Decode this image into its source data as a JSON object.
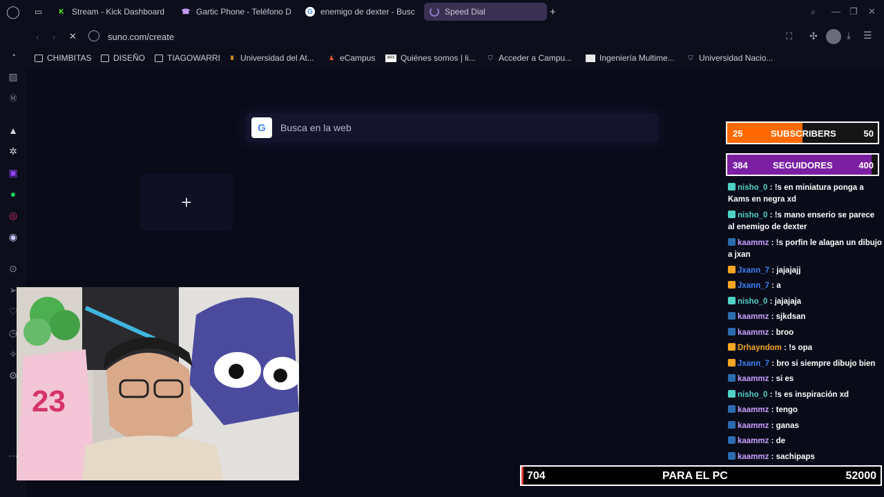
{
  "tabs": [
    {
      "label": "Stream - Kick Dashboard",
      "favicon": "K",
      "color": "#53fc18"
    },
    {
      "label": "Gartic Phone - Teléfono D",
      "favicon": "☎",
      "color": "#9b5de5"
    },
    {
      "label": "enemigo de dexter - Busc",
      "favicon": "G",
      "color": "#ffffff"
    },
    {
      "label": "Speed Dial",
      "favicon": "loading-spinner",
      "color": "#8b7cc8"
    }
  ],
  "address": {
    "url": "suno.com/create"
  },
  "bookmarks": [
    {
      "label": "CHIMBITAS",
      "icon": "folder-icon"
    },
    {
      "label": "DISEÑO",
      "icon": "folder-icon"
    },
    {
      "label": "TIAGOWARRI",
      "icon": "folder-icon"
    },
    {
      "label": "Universidad del At...",
      "icon": "university-icon"
    },
    {
      "label": "eCampus",
      "icon": "ecampus-icon"
    },
    {
      "label": "Quiénes somos | li...",
      "icon": "wix-icon"
    },
    {
      "label": "Acceder a Campu...",
      "icon": "shield-icon"
    },
    {
      "label": "Ingeniería Multime...",
      "icon": "doc-icon"
    },
    {
      "label": "Universidad Nacio...",
      "icon": "shield-icon"
    }
  ],
  "search": {
    "placeholder": "Busca en la web",
    "logo": "G"
  },
  "speed_dial": {
    "add_symbol": "+"
  },
  "overlay": {
    "subscribers": {
      "current": "25",
      "label": "SUBSCRIBERS",
      "goal": "50",
      "progress": 0.5,
      "color": "#ff6a00"
    },
    "followers": {
      "current": "384",
      "label": "SEGUIDORES",
      "goal": "400",
      "progress": 0.96,
      "color": "#7b1fa2"
    },
    "bottom": {
      "left": "704",
      "center": "PARA EL PC",
      "right": "52000"
    }
  },
  "chat": [
    {
      "user": "nisho_0",
      "text": "!s en miniatura ponga a Kams en negra xd",
      "color": "#4fd1c5"
    },
    {
      "user": "nisho_0",
      "text": "!s mano enserio se parece al enemigo de dexter",
      "color": "#4fd1c5"
    },
    {
      "user": "kaammz",
      "text": "!s porfin le alagan un dibujo a jxan",
      "color": "#c9a0ff"
    },
    {
      "user": "Jxann_7",
      "text": "jajajajj",
      "color": "#3b82f6"
    },
    {
      "user": "Jxann_7",
      "text": "a",
      "color": "#3b82f6"
    },
    {
      "user": "nisho_0",
      "text": "jajajaja",
      "color": "#4fd1c5"
    },
    {
      "user": "kaammz",
      "text": "sjkdsan",
      "color": "#c9a0ff"
    },
    {
      "user": "kaammz",
      "text": "broo",
      "color": "#c9a0ff"
    },
    {
      "user": "Drhayndom",
      "text": "!s opa",
      "color": "#f5a623"
    },
    {
      "user": "Jxann_7",
      "text": "bro si siempre dibujo bien",
      "color": "#3b82f6"
    },
    {
      "user": "kaammz",
      "text": "si es",
      "color": "#c9a0ff"
    },
    {
      "user": "nisho_0",
      "text": "!s es inspiración xd",
      "color": "#4fd1c5"
    },
    {
      "user": "kaammz",
      "text": "tengo",
      "color": "#c9a0ff"
    },
    {
      "user": "kaammz",
      "text": "ganas",
      "color": "#c9a0ff"
    },
    {
      "user": "kaammz",
      "text": "de",
      "color": "#c9a0ff"
    },
    {
      "user": "kaammz",
      "text": "sachipaps",
      "color": "#c9a0ff"
    }
  ]
}
